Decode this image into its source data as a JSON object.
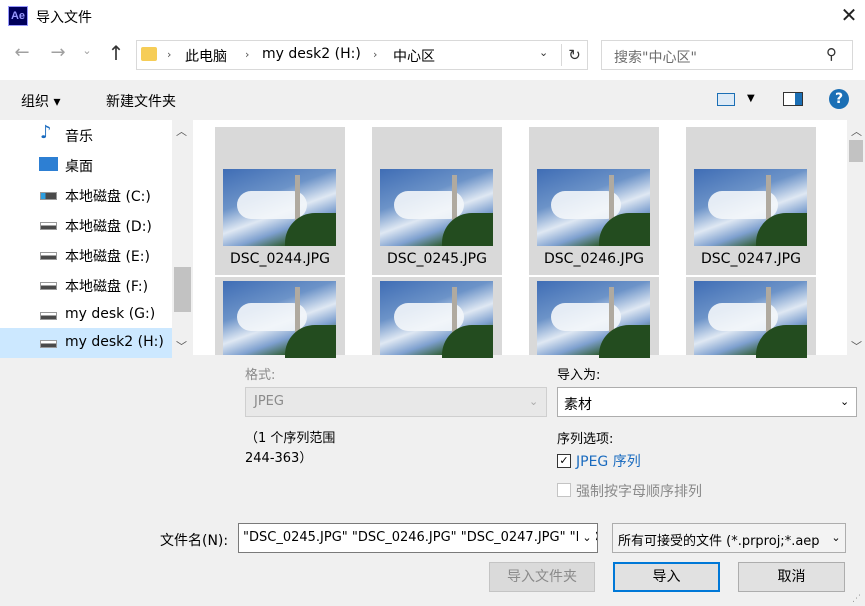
{
  "window": {
    "title": "导入文件",
    "app_icon": "Ae"
  },
  "nav": {
    "breadcrumb": [
      "此电脑",
      "my desk2 (H:)",
      "中心区"
    ],
    "search_placeholder": "搜索\"中心区\""
  },
  "toolbar": {
    "organize": "组织 ▾",
    "new_folder": "新建文件夹"
  },
  "sidebar": {
    "items": [
      {
        "label": "音乐",
        "icon": "music-icon"
      },
      {
        "label": "桌面",
        "icon": "desktop-icon"
      },
      {
        "label": "本地磁盘 (C:)",
        "icon": "system-drive-icon"
      },
      {
        "label": "本地磁盘 (D:)",
        "icon": "drive-icon"
      },
      {
        "label": "本地磁盘 (E:)",
        "icon": "drive-icon"
      },
      {
        "label": "本地磁盘 (F:)",
        "icon": "drive-icon"
      },
      {
        "label": "my desk (G:)",
        "icon": "drive-icon"
      },
      {
        "label": "my desk2 (H:)",
        "icon": "drive-icon",
        "selected": true
      }
    ]
  },
  "files": {
    "row1": [
      "DSC_0244.JPG",
      "DSC_0245.JPG",
      "DSC_0246.JPG",
      "DSC_0247.JPG"
    ]
  },
  "options": {
    "format_label": "格式:",
    "format_value": "JPEG",
    "sequence_range_line1": "（1 个序列范围",
    "sequence_range_line2": "244-363）",
    "import_as_label": "导入为:",
    "import_as_value": "素材",
    "sequence_options_label": "序列选项:",
    "jpeg_sequence_label": "JPEG 序列",
    "jpeg_sequence_checked": true,
    "alpha_order_label": "强制按字母顺序排列",
    "alpha_order_checked": false
  },
  "filename": {
    "label": "文件名(N):",
    "value": "\"DSC_0245.JPG\" \"DSC_0246.JPG\" \"DSC_0247.JPG\" \"DSC_0",
    "filter": "所有可接受的文件 (*.prproj;*.aep"
  },
  "buttons": {
    "import_folder": "导入文件夹",
    "import": "导入",
    "cancel": "取消"
  },
  "colors": {
    "accent": "#0078d7",
    "selection": "#cce8ff",
    "link": "#1a6bbf"
  }
}
